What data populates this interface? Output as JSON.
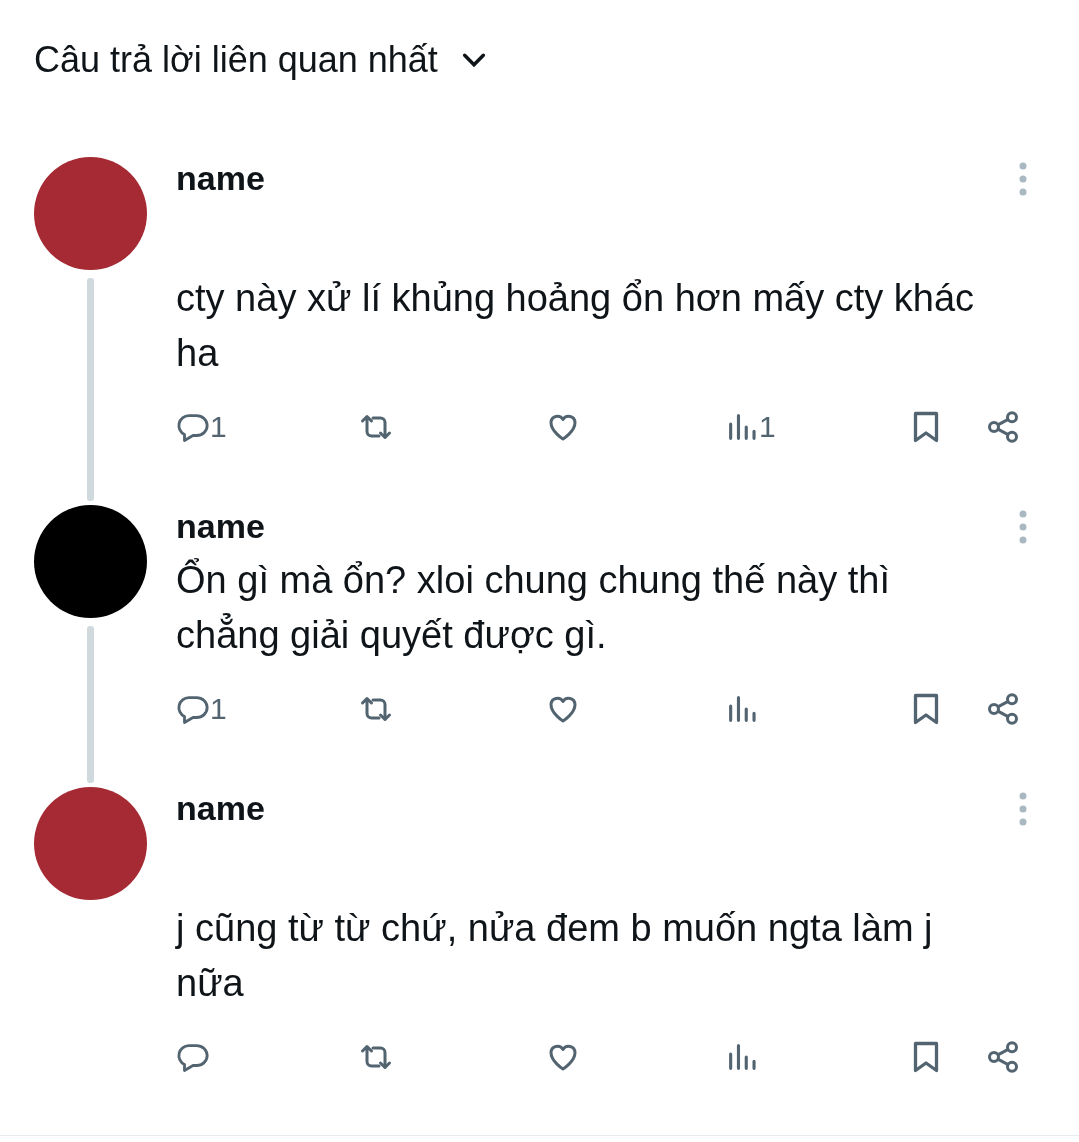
{
  "header": {
    "title": "Câu trả lời liên quan nhất"
  },
  "replies": [
    {
      "name": "name",
      "kind": "spaced",
      "color": "#a52a33",
      "text": "cty này xử lí khủng hoảng ổn hơn mấy cty khác ha",
      "reply_count": "1",
      "view_count": "1"
    },
    {
      "name": "name",
      "kind": "compact",
      "color": "#000000",
      "text": "Ổn gì mà ổn? xloi chung chung thế này thì chẳng giải quyết được gì.",
      "reply_count": "1"
    },
    {
      "name": "name",
      "kind": "spaced",
      "color": "#a52a33",
      "text": "j cũng từ từ chứ, nửa đem b muốn ngta làm j nữa"
    }
  ]
}
